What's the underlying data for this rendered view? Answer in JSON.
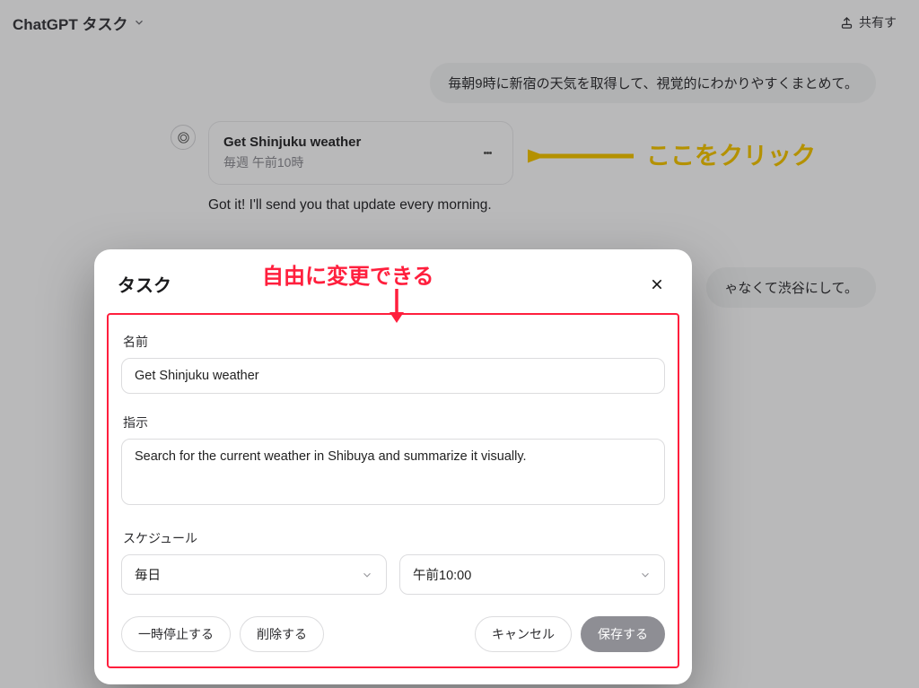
{
  "header": {
    "title": "ChatGPT タスク",
    "share": "共有す"
  },
  "chat": {
    "user1": "毎朝9時に新宿の天気を取得して、視覚的にわかりやすくまとめて。",
    "asst1_text": "Got it! I'll send you that update every morning.",
    "task_card": {
      "title": "Get Shinjuku weather",
      "schedule": "毎週 午前10時"
    },
    "user2": "ゃなくて渋谷にして。"
  },
  "annotation": {
    "click_here": "ここをクリック",
    "free_change": "自由に変更できる"
  },
  "modal": {
    "title": "タスク",
    "labels": {
      "name": "名前",
      "instruction": "指示",
      "schedule": "スケジュール"
    },
    "values": {
      "name": "Get Shinjuku weather",
      "instruction": "Search for the current weather in Shibuya and summarize it visually.",
      "freq": "毎日",
      "time": "午前10:00"
    },
    "buttons": {
      "pause": "一時停止する",
      "delete": "削除する",
      "cancel": "キャンセル",
      "save": "保存する"
    }
  }
}
